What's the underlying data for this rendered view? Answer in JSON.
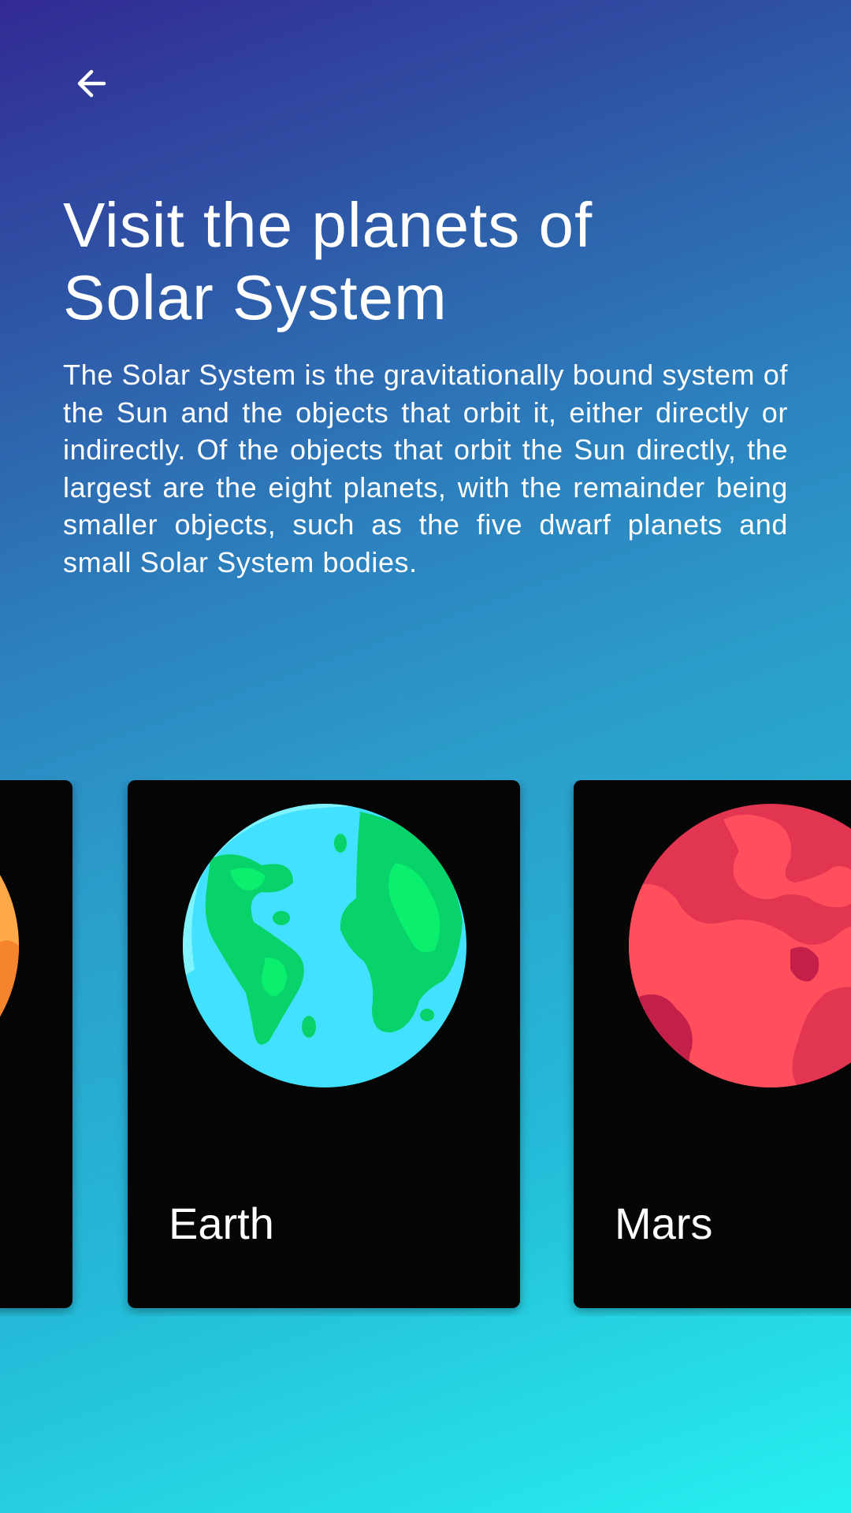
{
  "header": {
    "back_icon": "arrow-left-icon"
  },
  "main": {
    "title_line1": "Visit the planets of",
    "title_line2": "Solar System",
    "description": "The Solar System is the gravitationally bound system of the Sun and the objects that orbit it, either directly or indirectly. Of the objects that orbit the Sun directly, the largest are the eight planets, with the remainder being smaller objects, such as the five dwarf planets and small Solar System bodies."
  },
  "planets": [
    {
      "label": "",
      "icon": "sun-icon",
      "color": "#ffa84a"
    },
    {
      "label": "Earth",
      "icon": "earth-icon",
      "color": "#41e1ff"
    },
    {
      "label": "Mars",
      "icon": "mars-icon",
      "color": "#e23552"
    }
  ],
  "colors": {
    "card_bg": "#050505",
    "gradient_top": "#322a93",
    "gradient_bottom": "#26f0ef"
  }
}
